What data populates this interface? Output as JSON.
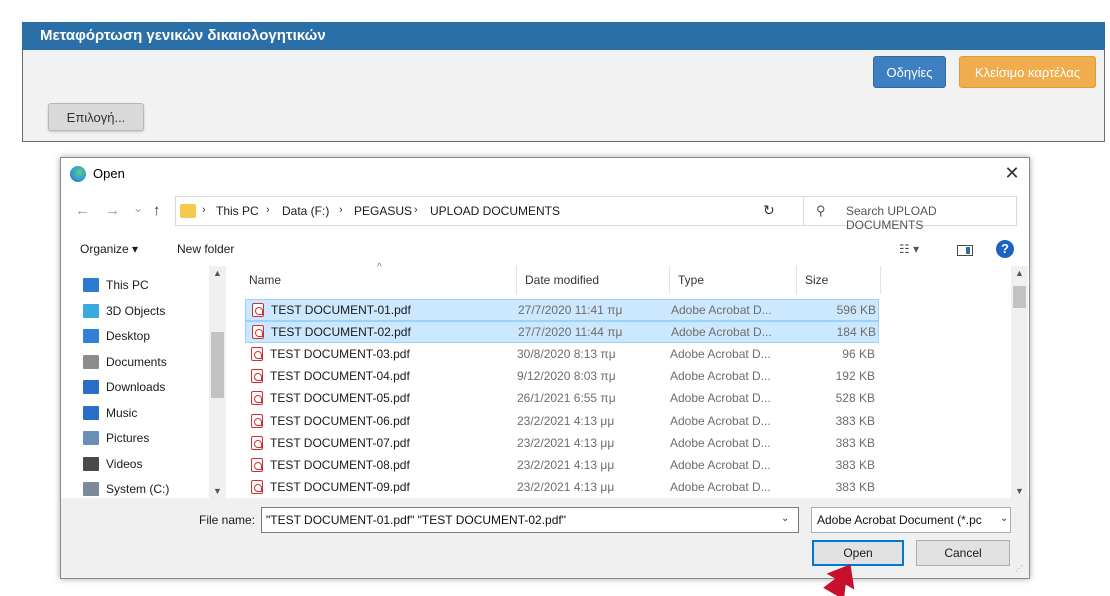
{
  "panel": {
    "title": "Μεταφόρτωση γενικών δικαιολογητικών",
    "instructions_label": "Οδηγίες",
    "close_tab_label": "Κλείσιμο καρτέλας",
    "select_label": "Επιλογή..."
  },
  "dialog": {
    "title": "Open",
    "close_glyph": "✕",
    "nav": {
      "back": "←",
      "forward": "→",
      "recent": "⌄",
      "up": "↑",
      "breadcrumb": [
        "This PC",
        "Data (F:)",
        "PEGASUS",
        "UPLOAD DOCUMENTS"
      ],
      "separator": "›",
      "refresh": "↻",
      "search_placeholder": "Search UPLOAD DOCUMENTS"
    },
    "toolbar": {
      "organize": "Organize ▾",
      "new_folder": "New folder",
      "help": "?"
    },
    "sidebar": [
      {
        "label": "This PC",
        "icon": "computer-icon",
        "color": "#2b7bd0"
      },
      {
        "label": "3D Objects",
        "icon": "cube-icon",
        "color": "#39a9e0"
      },
      {
        "label": "Desktop",
        "icon": "desktop-icon",
        "color": "#2f7fd6"
      },
      {
        "label": "Documents",
        "icon": "documents-icon",
        "color": "#8c8c8c"
      },
      {
        "label": "Downloads",
        "icon": "download-icon",
        "color": "#2a6fc7"
      },
      {
        "label": "Music",
        "icon": "music-icon",
        "color": "#2a6fc7"
      },
      {
        "label": "Pictures",
        "icon": "pictures-icon",
        "color": "#6a8fb5"
      },
      {
        "label": "Videos",
        "icon": "videos-icon",
        "color": "#4a4a4a"
      },
      {
        "label": "System (C:)",
        "icon": "drive-icon",
        "color": "#7a8a9a"
      }
    ],
    "columns": {
      "name": "Name",
      "date": "Date modified",
      "type": "Type",
      "size": "Size"
    },
    "files": [
      {
        "name": "TEST DOCUMENT-01.pdf",
        "date": "27/7/2020 11:41 πμ",
        "type": "Adobe Acrobat D...",
        "size": "596 KB",
        "selected": true
      },
      {
        "name": "TEST DOCUMENT-02.pdf",
        "date": "27/7/2020 11:44 πμ",
        "type": "Adobe Acrobat D...",
        "size": "184 KB",
        "selected": true
      },
      {
        "name": "TEST DOCUMENT-03.pdf",
        "date": "30/8/2020 8:13 πμ",
        "type": "Adobe Acrobat D...",
        "size": "96 KB",
        "selected": false
      },
      {
        "name": "TEST DOCUMENT-04.pdf",
        "date": "9/12/2020 8:03 πμ",
        "type": "Adobe Acrobat D...",
        "size": "192 KB",
        "selected": false
      },
      {
        "name": "TEST DOCUMENT-05.pdf",
        "date": "26/1/2021 6:55 πμ",
        "type": "Adobe Acrobat D...",
        "size": "528 KB",
        "selected": false
      },
      {
        "name": "TEST DOCUMENT-06.pdf",
        "date": "23/2/2021 4:13 μμ",
        "type": "Adobe Acrobat D...",
        "size": "383 KB",
        "selected": false
      },
      {
        "name": "TEST DOCUMENT-07.pdf",
        "date": "23/2/2021 4:13 μμ",
        "type": "Adobe Acrobat D...",
        "size": "383 KB",
        "selected": false
      },
      {
        "name": "TEST DOCUMENT-08.pdf",
        "date": "23/2/2021 4:13 μμ",
        "type": "Adobe Acrobat D...",
        "size": "383 KB",
        "selected": false
      },
      {
        "name": "TEST DOCUMENT-09.pdf",
        "date": "23/2/2021 4:13 μμ",
        "type": "Adobe Acrobat D...",
        "size": "383 KB",
        "selected": false
      }
    ],
    "footer": {
      "file_name_label": "File name:",
      "file_name_value": "\"TEST DOCUMENT-01.pdf\" \"TEST DOCUMENT-02.pdf\"",
      "file_type_value": "Adobe Acrobat Document (*.pc",
      "open_label": "Open",
      "cancel_label": "Cancel"
    }
  },
  "colors": {
    "header_blue": "#2b6fa8",
    "instructions_button": "#3d7fc0",
    "close_tab_button": "#f0ad4e",
    "selection": "#cce8ff",
    "arrow_red": "#c8102e"
  }
}
